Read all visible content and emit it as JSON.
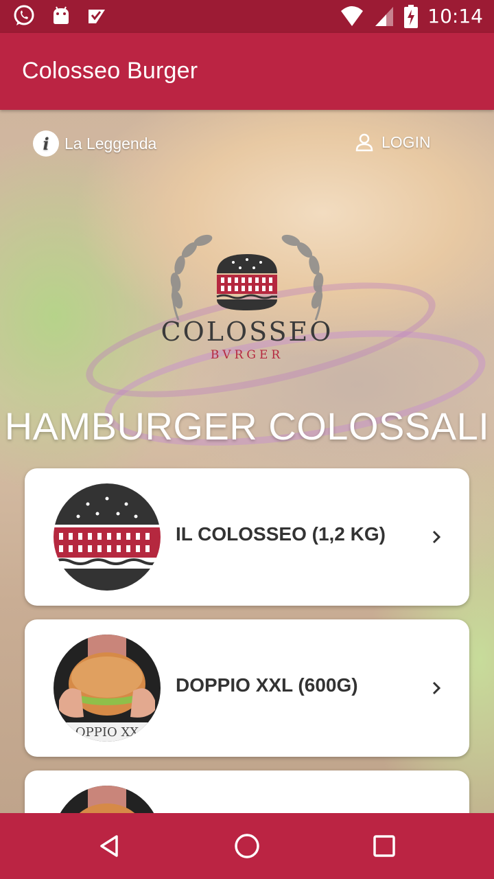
{
  "status_bar": {
    "time": "10:14",
    "left_icons": [
      "whatsapp-icon",
      "android-icon",
      "task-check-icon"
    ],
    "right_icons": [
      "wifi-icon",
      "signal-icon",
      "battery-charging-icon"
    ]
  },
  "app_bar": {
    "title": "Colosseo Burger"
  },
  "top_links": {
    "legend_label": "La Leggenda",
    "login_label": "LOGIN"
  },
  "logo": {
    "name": "COLOSSEO",
    "subname": "BVRGER"
  },
  "headline": "HAMBURGER COLOSSALI",
  "menu_items": [
    {
      "label": "IL COLOSSEO (1,2 KG)",
      "icon": "colosseo-burger-thumbnail"
    },
    {
      "label": "DOPPIO XXL (600G)",
      "icon": "doppio-xxl-thumbnail",
      "thumb_text": "OPPIO XX"
    },
    {
      "label": "",
      "icon": "burger-thumbnail"
    }
  ],
  "colors": {
    "status_bar": "#9c1b34",
    "app_bar": "#bb2443",
    "nav_bar": "#bb2443",
    "logo_red": "#b5283f"
  },
  "nav_bar": {
    "buttons": [
      "back-icon",
      "home-icon",
      "recents-icon"
    ]
  }
}
